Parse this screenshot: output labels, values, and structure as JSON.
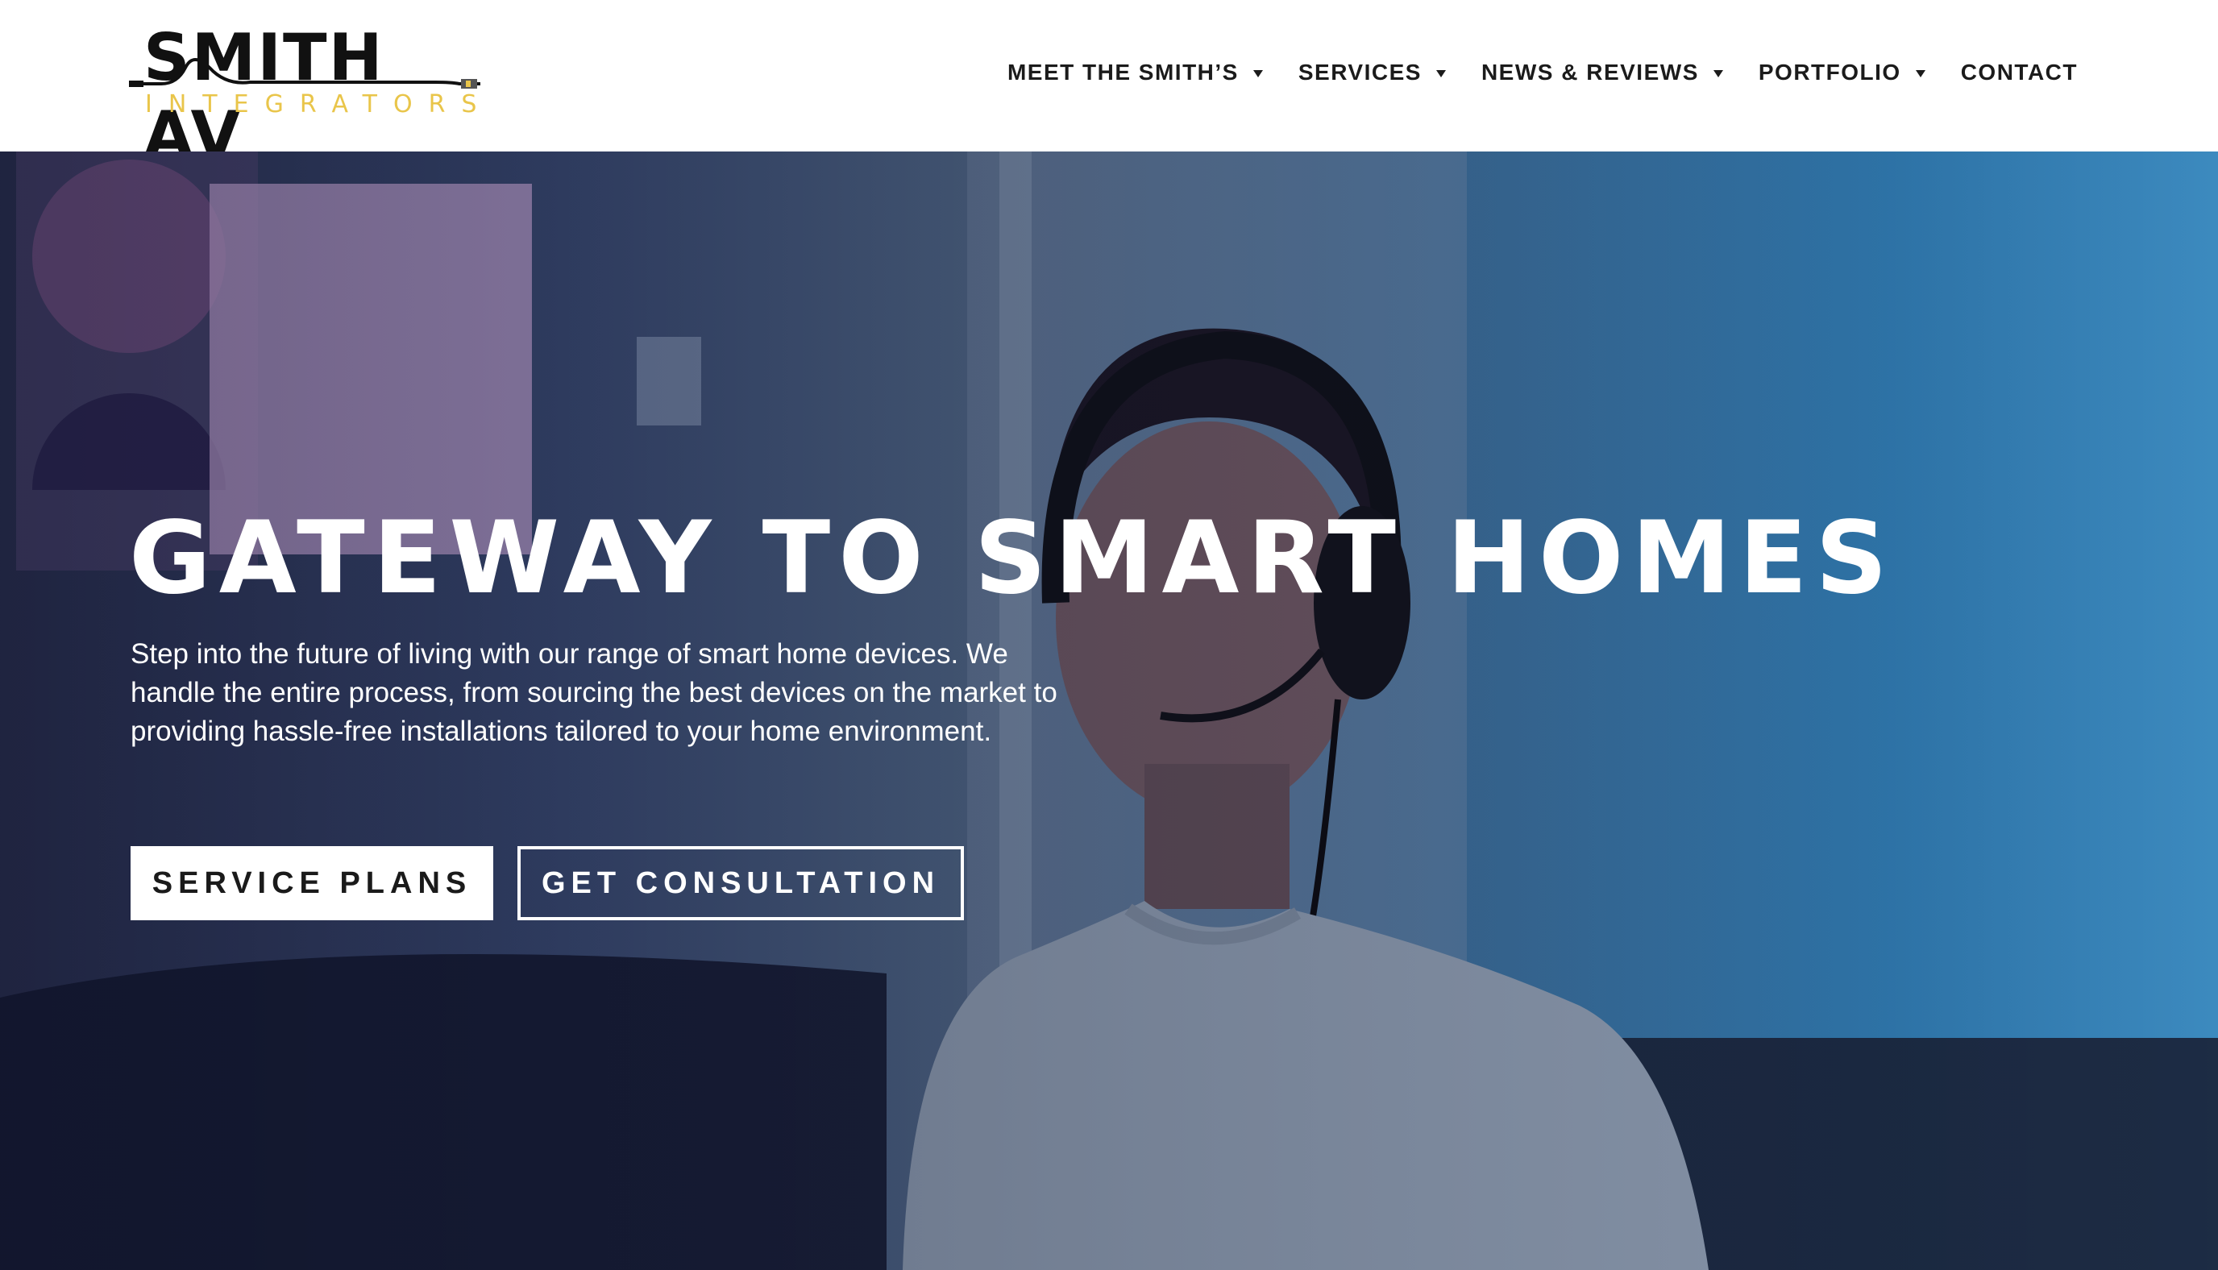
{
  "brand": {
    "name": "SMITH AV",
    "tagline": "INTEGRATORS",
    "accent_color": "#e9c54a"
  },
  "nav": {
    "items": [
      {
        "label": "MEET THE SMITH’S",
        "has_dropdown": true
      },
      {
        "label": "SERVICES",
        "has_dropdown": true
      },
      {
        "label": "NEWS & REVIEWS",
        "has_dropdown": true
      },
      {
        "label": "PORTFOLIO",
        "has_dropdown": true
      },
      {
        "label": "CONTACT",
        "has_dropdown": false
      }
    ],
    "dropdown_icon": "caret-down-icon"
  },
  "hero": {
    "title": "GATEWAY TO SMART HOMES",
    "description": "Step into the future of living with our range of smart home devices. We handle the entire process, from sourcing the best devices on the market to providing hassle-free installations tailored to your home environment.",
    "primary_button": "SERVICE PLANS",
    "secondary_button": "GET CONSULTATION",
    "background_image": "man-wearing-headset-on-couch"
  }
}
